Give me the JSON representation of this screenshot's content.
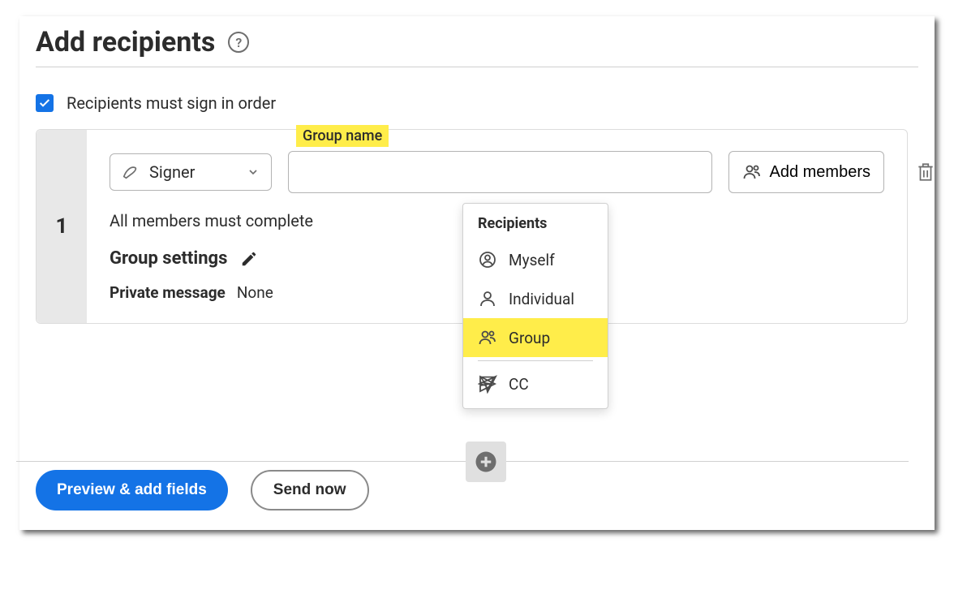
{
  "header": {
    "title": "Add recipients"
  },
  "order": {
    "label": "Recipients must sign in order",
    "checked": true
  },
  "recipient": {
    "index": "1",
    "group_name_label": "Group name",
    "role": {
      "label": "Signer"
    },
    "group_name_value": "",
    "add_members_label": "Add members",
    "subtext": "All members must complete",
    "settings_label": "Group settings",
    "private_message_label": "Private message",
    "private_message_value": "None"
  },
  "dropdown": {
    "header": "Recipients",
    "items": [
      {
        "icon": "person-circle-icon",
        "label": "Myself",
        "highlighted": false
      },
      {
        "icon": "person-icon",
        "label": "Individual",
        "highlighted": false
      },
      {
        "icon": "group-icon",
        "label": "Group",
        "highlighted": true
      }
    ],
    "cc": {
      "label": "CC"
    }
  },
  "actions": {
    "primary": "Preview & add fields",
    "secondary": "Send now"
  }
}
